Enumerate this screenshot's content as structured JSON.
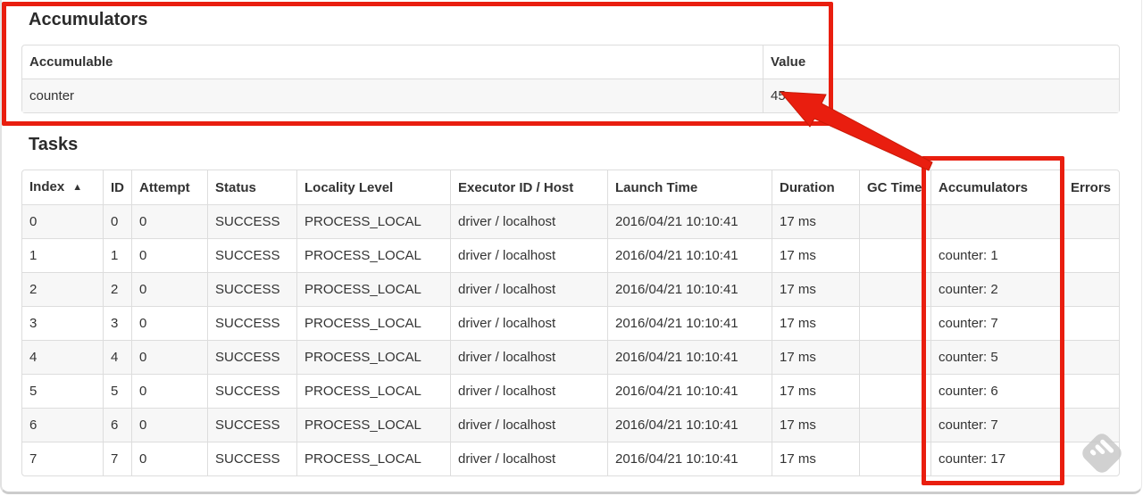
{
  "colors": {
    "annotation_red": "#e91e0f",
    "table_border": "#dddddd",
    "striped_row_bg": "#f7f7f7",
    "text": "#333333",
    "watermark_gray": "#c9c9c9"
  },
  "accumulators_section": {
    "title": "Accumulators",
    "table": {
      "headers": [
        "Accumulable",
        "Value"
      ],
      "rows": [
        {
          "accumulable": "counter",
          "value": "45"
        }
      ]
    }
  },
  "tasks_section": {
    "title": "Tasks",
    "table": {
      "headers": [
        "Index",
        "ID",
        "Attempt",
        "Status",
        "Locality Level",
        "Executor ID / Host",
        "Launch Time",
        "Duration",
        "GC Time",
        "Accumulators",
        "Errors"
      ],
      "sort_indicator": "▲",
      "rows": [
        {
          "index": "0",
          "id": "0",
          "attempt": "0",
          "status": "SUCCESS",
          "locality_level": "PROCESS_LOCAL",
          "executor_id_host": "driver / localhost",
          "launch_time": "2016/04/21 10:10:41",
          "duration": "17 ms",
          "gc_time": "",
          "accumulators": "",
          "errors": ""
        },
        {
          "index": "1",
          "id": "1",
          "attempt": "0",
          "status": "SUCCESS",
          "locality_level": "PROCESS_LOCAL",
          "executor_id_host": "driver / localhost",
          "launch_time": "2016/04/21 10:10:41",
          "duration": "17 ms",
          "gc_time": "",
          "accumulators": "counter: 1",
          "errors": ""
        },
        {
          "index": "2",
          "id": "2",
          "attempt": "0",
          "status": "SUCCESS",
          "locality_level": "PROCESS_LOCAL",
          "executor_id_host": "driver / localhost",
          "launch_time": "2016/04/21 10:10:41",
          "duration": "17 ms",
          "gc_time": "",
          "accumulators": "counter: 2",
          "errors": ""
        },
        {
          "index": "3",
          "id": "3",
          "attempt": "0",
          "status": "SUCCESS",
          "locality_level": "PROCESS_LOCAL",
          "executor_id_host": "driver / localhost",
          "launch_time": "2016/04/21 10:10:41",
          "duration": "17 ms",
          "gc_time": "",
          "accumulators": "counter: 7",
          "errors": ""
        },
        {
          "index": "4",
          "id": "4",
          "attempt": "0",
          "status": "SUCCESS",
          "locality_level": "PROCESS_LOCAL",
          "executor_id_host": "driver / localhost",
          "launch_time": "2016/04/21 10:10:41",
          "duration": "17 ms",
          "gc_time": "",
          "accumulators": "counter: 5",
          "errors": ""
        },
        {
          "index": "5",
          "id": "5",
          "attempt": "0",
          "status": "SUCCESS",
          "locality_level": "PROCESS_LOCAL",
          "executor_id_host": "driver / localhost",
          "launch_time": "2016/04/21 10:10:41",
          "duration": "17 ms",
          "gc_time": "",
          "accumulators": "counter: 6",
          "errors": ""
        },
        {
          "index": "6",
          "id": "6",
          "attempt": "0",
          "status": "SUCCESS",
          "locality_level": "PROCESS_LOCAL",
          "executor_id_host": "driver / localhost",
          "launch_time": "2016/04/21 10:10:41",
          "duration": "17 ms",
          "gc_time": "",
          "accumulators": "counter: 7",
          "errors": ""
        },
        {
          "index": "7",
          "id": "7",
          "attempt": "0",
          "status": "SUCCESS",
          "locality_level": "PROCESS_LOCAL",
          "executor_id_host": "driver / localhost",
          "launch_time": "2016/04/21 10:10:41",
          "duration": "17 ms",
          "gc_time": "",
          "accumulators": "counter: 17",
          "errors": ""
        }
      ]
    }
  },
  "annotations": {
    "highlighted_value": "45",
    "highlighted_column": "Accumulators"
  },
  "watermark_icon": "feedly-stripes-badge"
}
